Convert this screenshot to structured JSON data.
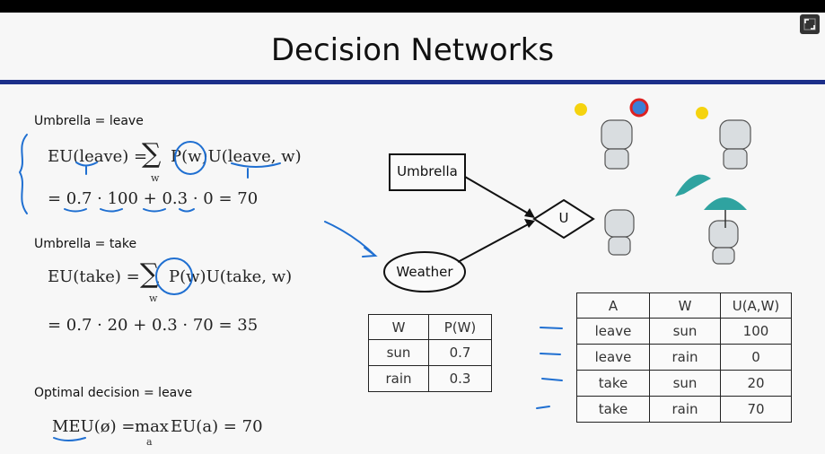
{
  "slide": {
    "title": "Decision Networks",
    "case1": {
      "heading": "Umbrella = leave",
      "eq1": "EU(leave) = ",
      "eq1_sum": "∑",
      "eq1_sub": "w",
      "eq1_rest": "P(w)U(leave, w)",
      "eq2": "= 0.7 · 100 + 0.3 · 0 = 70"
    },
    "case2": {
      "heading": "Umbrella = take",
      "eq1": "EU(take) = ",
      "eq1_sum": "∑",
      "eq1_sub": "w",
      "eq1_rest": "P(w)U(take, w)",
      "eq2": "= 0.7 · 20 + 0.3 · 70 = 35"
    },
    "optimal": {
      "heading": "Optimal decision = leave",
      "eq": "MEU(∅) = max EU(a) = 70",
      "eq_main": "MEU(ø) = ",
      "eq_max": "max",
      "eq_sub": "a",
      "eq_rest": "EU(a) = 70"
    },
    "diagram": {
      "umbrella": "Umbrella",
      "weather": "Weather",
      "utility": "U"
    },
    "pw_table": {
      "headers": [
        "W",
        "P(W)"
      ],
      "rows": [
        [
          "sun",
          "0.7"
        ],
        [
          "rain",
          "0.3"
        ]
      ]
    },
    "u_table": {
      "headers": [
        "A",
        "W",
        "U(A,W)"
      ],
      "rows": [
        [
          "leave",
          "sun",
          "100"
        ],
        [
          "leave",
          "rain",
          "0"
        ],
        [
          "take",
          "sun",
          "20"
        ],
        [
          "take",
          "rain",
          "70"
        ]
      ]
    }
  },
  "colors": {
    "title_rule": "#1c2f8a",
    "annotation_ink": "#1f6fd1"
  },
  "icons": [
    "fullscreen-icon"
  ]
}
